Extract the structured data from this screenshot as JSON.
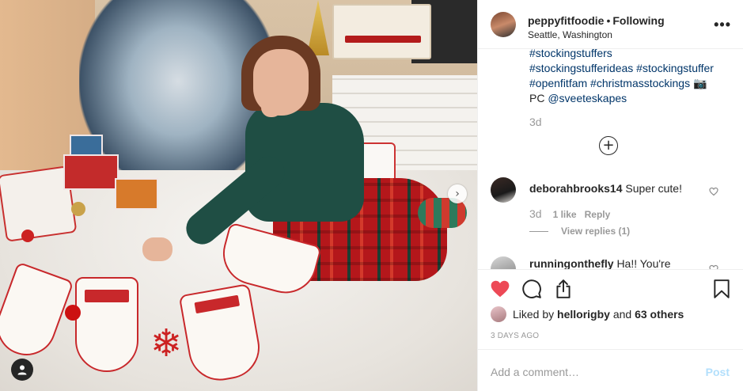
{
  "post": {
    "username": "peppyfitfoodie",
    "follow_status": "Following",
    "location": "Seattle, Washington",
    "more_glyph": "•••"
  },
  "caption": {
    "lines": [
      "#stockingstuffers",
      "#stockingstufferideas #stockingstuffer",
      "#openfitfam #christmasstockings 📷",
      "@sveeteskapes"
    ],
    "credit_prefix": "PC ",
    "time": "3d"
  },
  "load_more_glyph": "+",
  "comments": [
    {
      "username": "deborahbrooks14",
      "text": "Super cute!",
      "time": "3d",
      "likes": "1 like",
      "reply": "Reply",
      "view_replies": "View replies (1)"
    },
    {
      "username": "runningonthefly",
      "text": "Ha!! You're"
    }
  ],
  "likes": {
    "prefix": "Liked by ",
    "user": "hellorigby",
    "middle": " and ",
    "others": "63 others"
  },
  "date": "3 DAYS AGO",
  "add_comment": {
    "placeholder": "Add a comment…",
    "post_label": "Post"
  },
  "icons": {
    "like": "heart-filled-icon",
    "comment": "speech-bubble-icon",
    "share": "share-icon",
    "save": "bookmark-icon",
    "next": "chevron-right-icon",
    "tags": "user-tag-icon"
  },
  "colors": {
    "like_red": "#ed4956",
    "link_blue": "#003569",
    "post_disabled": "#b2dffc",
    "muted": "#999999"
  }
}
